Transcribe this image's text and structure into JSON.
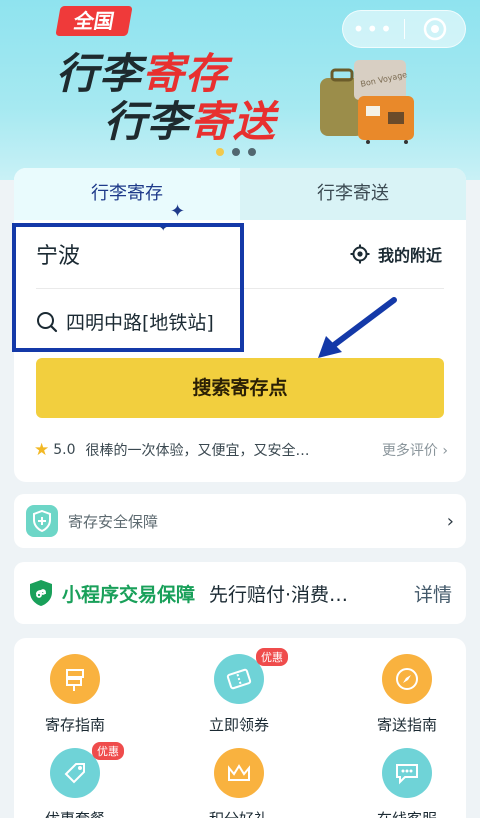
{
  "banner": {
    "badge": "全国",
    "line1_black": "行李",
    "line1_red": "寄存",
    "line2_black": "行李",
    "line2_red": "寄送",
    "dots": 3,
    "active_dot": 0,
    "suitcase_sticker": "Bon Voyage"
  },
  "capsule": {
    "more_label": "•••"
  },
  "tabs": [
    {
      "label": "行李寄存"
    },
    {
      "label": "行李寄送"
    }
  ],
  "search": {
    "city": "宁波",
    "nearby_label": "我的附近",
    "location": "四明中路[地铁站]",
    "button_label": "搜索寄存点"
  },
  "review": {
    "score": "5.0",
    "text": "很棒的一次体验，又便宜，又安全…",
    "more_label": "更多评价"
  },
  "safety": {
    "label": "寄存安全保障"
  },
  "guarantee": {
    "title": "小程序交易保障",
    "desc": "先行赔付·消费…",
    "detail_label": "详情"
  },
  "grid": [
    {
      "label": "寄存指南",
      "icon": "signpost-icon",
      "tag": ""
    },
    {
      "label": "立即领券",
      "icon": "ticket-icon",
      "tag": "优惠"
    },
    {
      "label": "寄送指南",
      "icon": "compass-icon",
      "tag": ""
    },
    {
      "label": "优惠套餐",
      "icon": "price-tag-icon",
      "tag": "优惠"
    },
    {
      "label": "积分好礼",
      "icon": "crown-icon",
      "tag": ""
    },
    {
      "label": "在线客服",
      "icon": "chat-icon",
      "tag": ""
    }
  ],
  "colors": {
    "accent_yellow": "#f2cf3e",
    "tab_active_text": "#1e3a8a",
    "guarantee_green": "#19a05a",
    "highlight_blue": "#1439a8"
  }
}
